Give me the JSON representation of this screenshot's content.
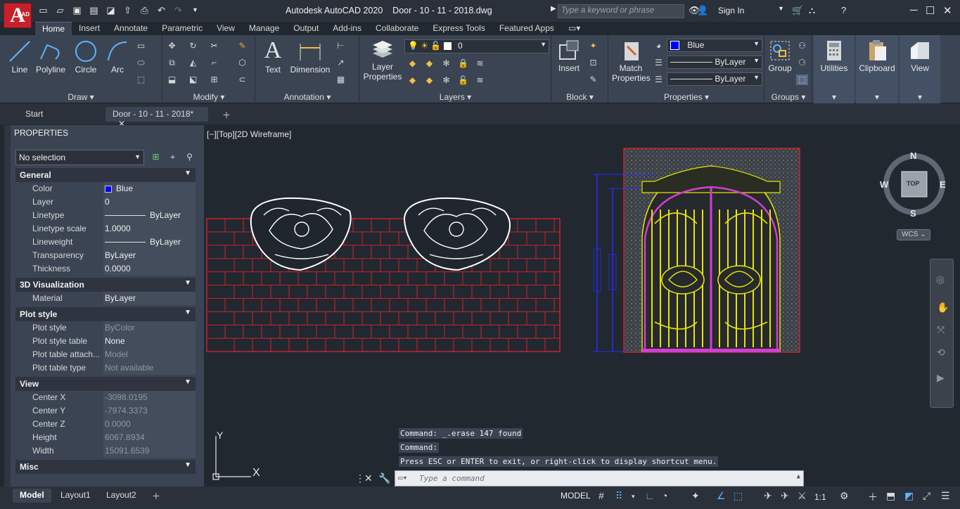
{
  "titlebar": {
    "app_letter": "A",
    "app_badge": "CAD",
    "title": "Autodesk AutoCAD 2020    Door - 10 - 11 - 2018.dwg",
    "search_placeholder": "Type a keyword or phrase",
    "signin": "Sign In"
  },
  "ribbon_tabs": [
    "Home",
    "Insert",
    "Annotate",
    "Parametric",
    "View",
    "Manage",
    "Output",
    "Add-ins",
    "Collaborate",
    "Express Tools",
    "Featured Apps"
  ],
  "ribbon": {
    "draw": {
      "title": "Draw",
      "line": "Line",
      "polyline": "Polyline",
      "circle": "Circle",
      "arc": "Arc"
    },
    "modify": {
      "title": "Modify"
    },
    "annotation": {
      "title": "Annotation",
      "text": "Text",
      "dimension": "Dimension"
    },
    "layers": {
      "title": "Layers",
      "layer_properties": "Layer\nProperties",
      "current_layer": "0"
    },
    "block": {
      "title": "Block",
      "insert": "Insert"
    },
    "properties": {
      "title": "Properties",
      "match": "Match\nProperties",
      "color": "Blue",
      "linetype": "ByLayer",
      "lineweight": "ByLayer"
    },
    "groups": {
      "title": "Groups",
      "group": "Group"
    },
    "utilities": "Utilities",
    "clipboard": "Clipboard",
    "view": "View"
  },
  "doc_tabs": {
    "start": "Start",
    "active": "Door - 10 - 11 - 2018*"
  },
  "properties_palette": {
    "title": "PROPERTIES",
    "selection": "No selection",
    "general": {
      "title": "General",
      "rows": [
        {
          "k": "Color",
          "v": "Blue"
        },
        {
          "k": "Layer",
          "v": "0"
        },
        {
          "k": "Linetype",
          "v": "ByLayer"
        },
        {
          "k": "Linetype scale",
          "v": "1.0000"
        },
        {
          "k": "Lineweight",
          "v": "ByLayer"
        },
        {
          "k": "Transparency",
          "v": "ByLayer"
        },
        {
          "k": "Thickness",
          "v": "0.0000"
        }
      ]
    },
    "viz3d": {
      "title": "3D Visualization",
      "rows": [
        {
          "k": "Material",
          "v": "ByLayer"
        }
      ]
    },
    "plot": {
      "title": "Plot style",
      "rows": [
        {
          "k": "Plot style",
          "v": "ByColor"
        },
        {
          "k": "Plot style table",
          "v": "None"
        },
        {
          "k": "Plot table attach...",
          "v": "Model"
        },
        {
          "k": "Plot table type",
          "v": "Not available"
        }
      ]
    },
    "view": {
      "title": "View",
      "rows": [
        {
          "k": "Center X",
          "v": "-3098.0195"
        },
        {
          "k": "Center Y",
          "v": "-7974.3373"
        },
        {
          "k": "Center Z",
          "v": "0.0000"
        },
        {
          "k": "Height",
          "v": "6067.8934"
        },
        {
          "k": "Width",
          "v": "15091.6539"
        }
      ]
    },
    "misc": {
      "title": "Misc"
    }
  },
  "viewport": {
    "controls": "[−][Top][2D Wireframe]",
    "compass": {
      "n": "N",
      "s": "S",
      "e": "E",
      "w": "W",
      "top": "TOP"
    },
    "wcs": "WCS",
    "ucs_x": "X",
    "ucs_y": "Y"
  },
  "command_line": {
    "history": [
      "Command:  _.erase 147 found",
      "Command:",
      "Press ESC or ENTER to exit, or right-click to display shortcut menu."
    ],
    "placeholder": "Type a command"
  },
  "status": {
    "tabs": [
      "Model",
      "Layout1",
      "Layout2"
    ],
    "model": "MODEL",
    "scale": "1:1"
  },
  "colors": {
    "accent_blue": "#0000ff",
    "brick": "#d1222b",
    "gate": "#e5e500",
    "frame": "#d23ed2"
  }
}
